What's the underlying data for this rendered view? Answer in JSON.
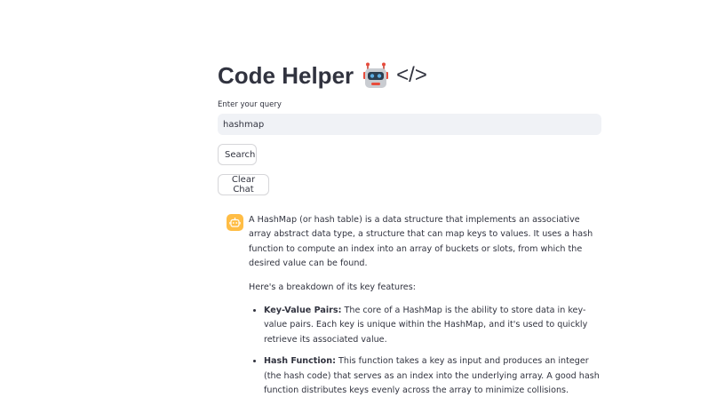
{
  "header": {
    "title": "Code Helper",
    "title_suffix": "</>",
    "emoji_icon": "robot-icon"
  },
  "query": {
    "label": "Enter your query",
    "value": "hashmap"
  },
  "buttons": {
    "search_label": "Search",
    "clear_label": "Clear Chat"
  },
  "chat": {
    "avatar_icon": "bot-icon",
    "avatar_color": "#ffbd45",
    "intro": "A HashMap (or hash table) is a data structure that implements an associative array abstract data type, a structure that can map keys to values. It uses a hash function to compute an index into an array of buckets or slots, from which the desired value can be found.",
    "breakdown": "Here's a breakdown of its key features:",
    "features": [
      {
        "term": "Key-Value Pairs:",
        "text": " The core of a HashMap is the ability to store data in key-value pairs. Each key is unique within the HashMap, and it's used to quickly retrieve its associated value."
      },
      {
        "term": "Hash Function:",
        "text": " This function takes a key as input and produces an integer (the hash code) that serves as an index into the underlying array. A good hash function distributes keys evenly across the array to minimize collisions."
      }
    ]
  }
}
